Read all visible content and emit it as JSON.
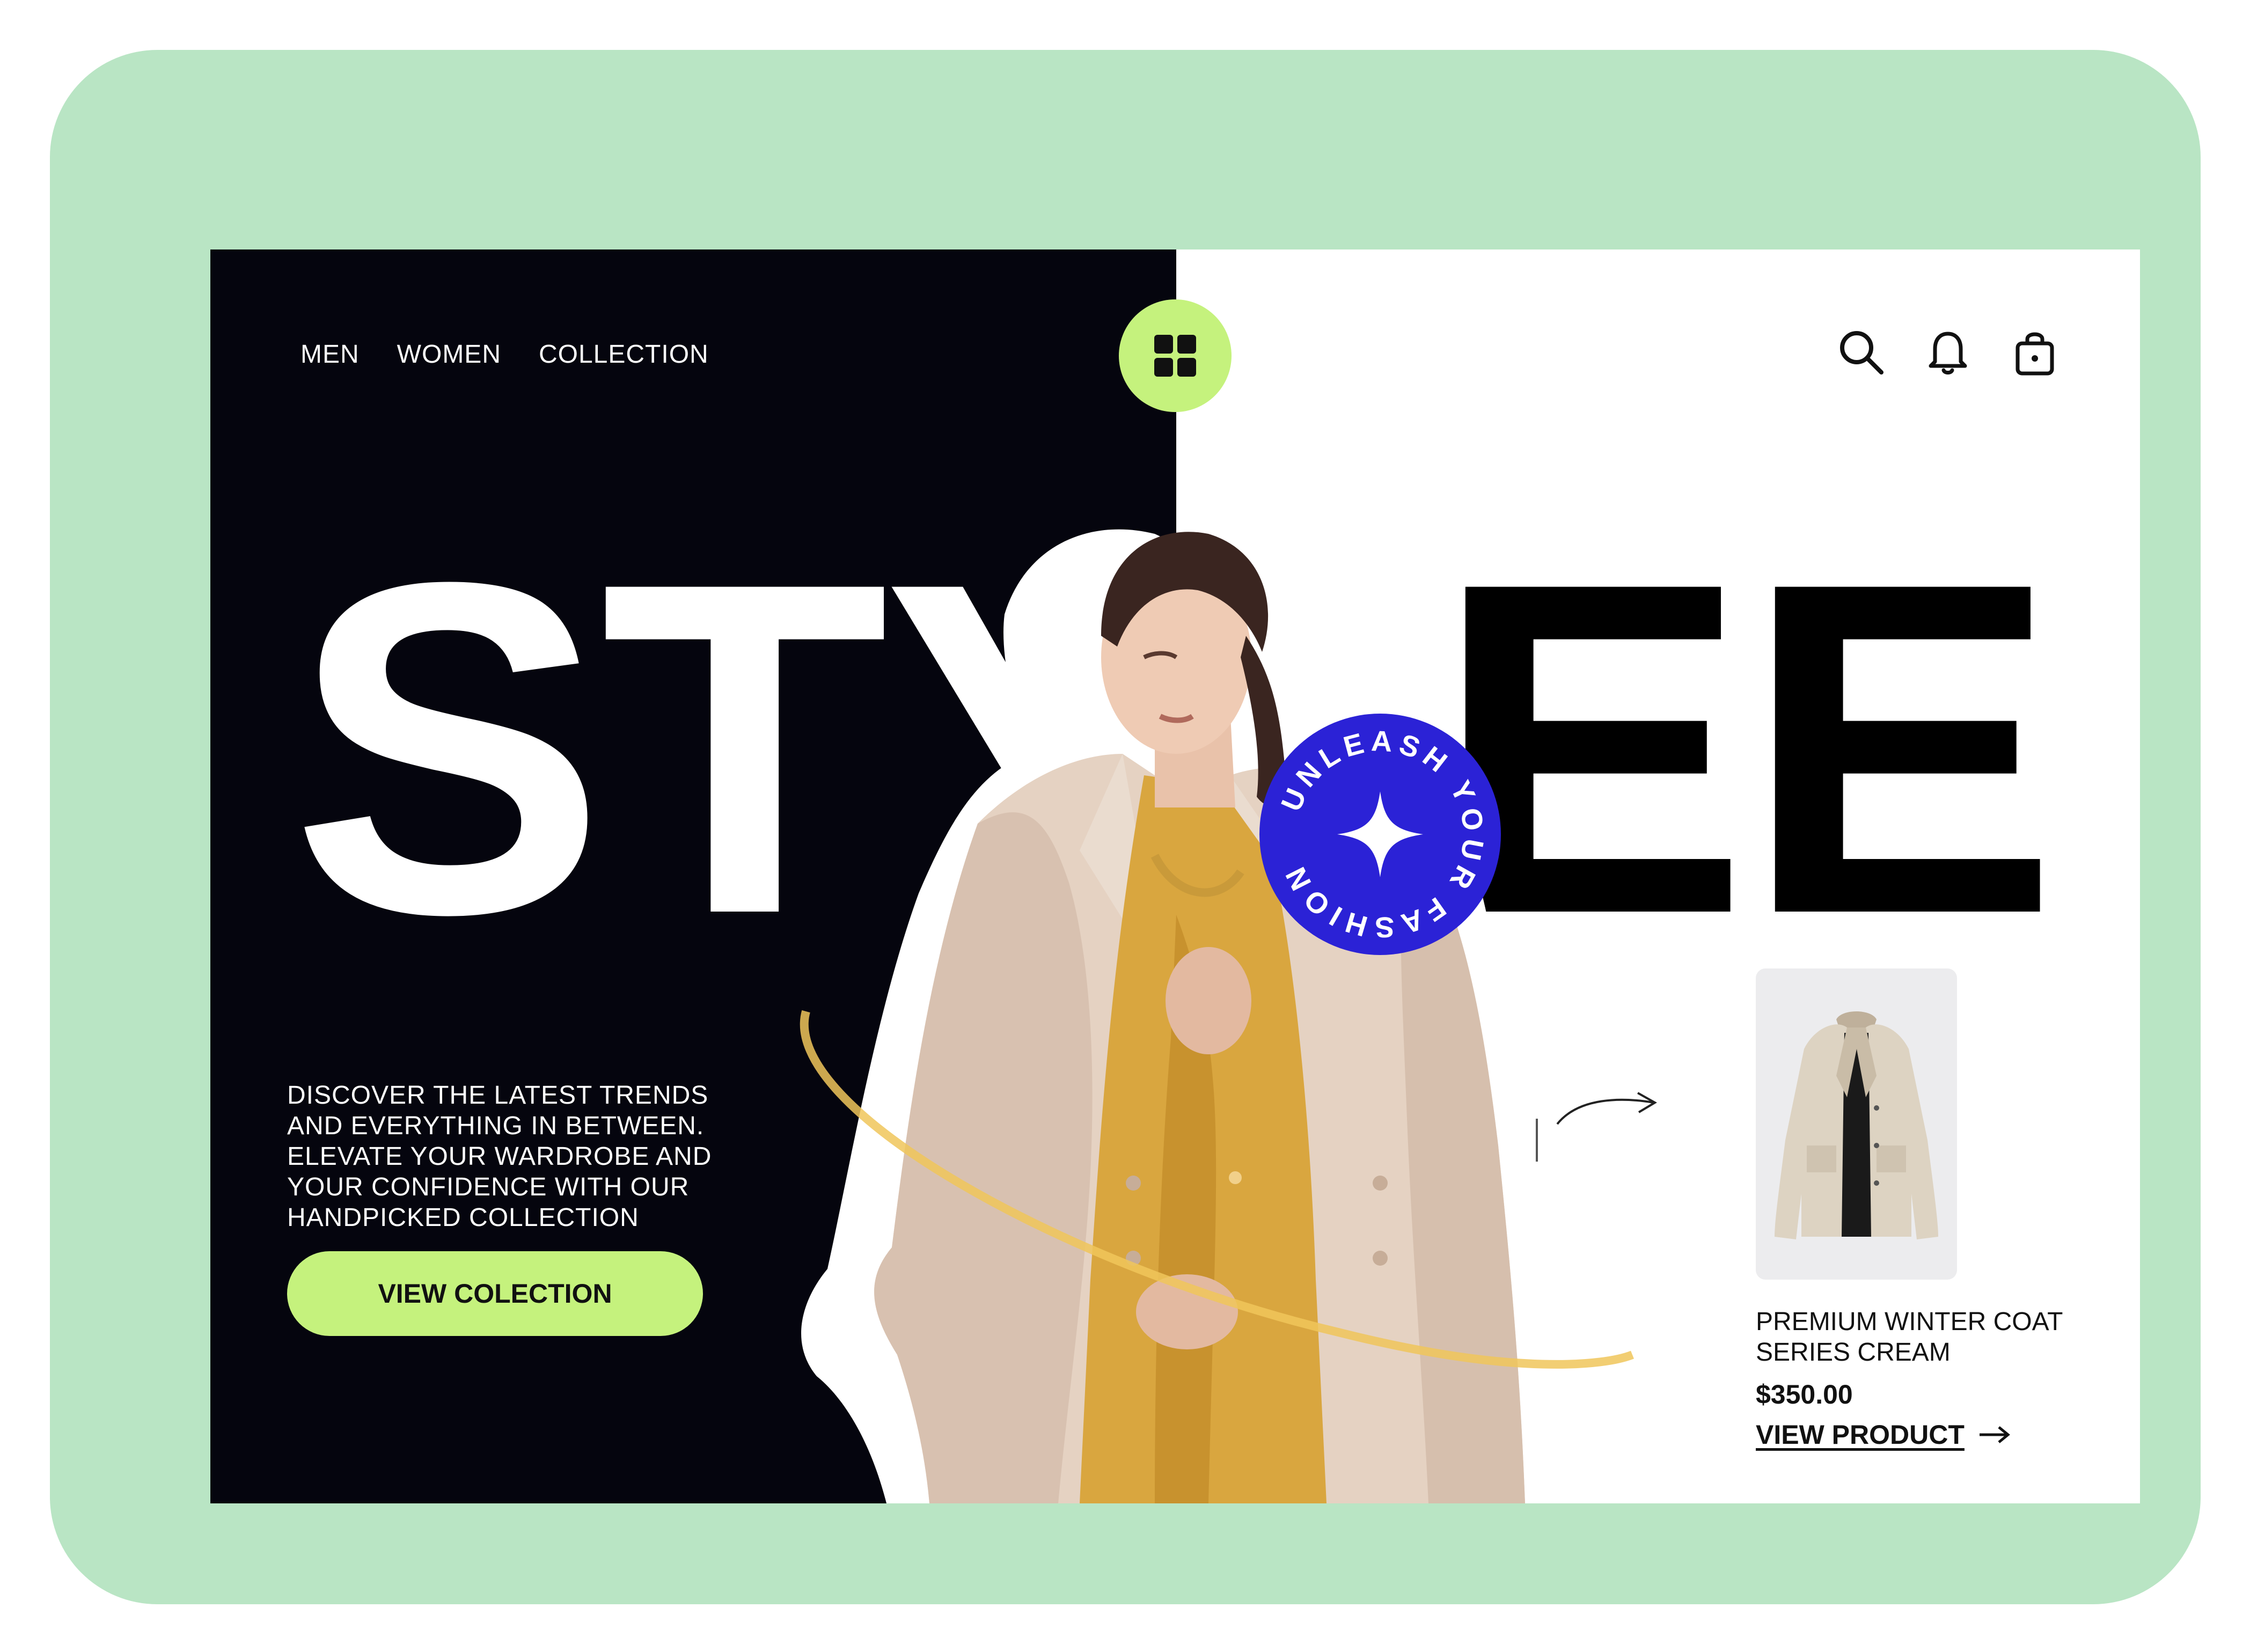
{
  "nav": {
    "items": [
      "MEN",
      "WOMEN",
      "COLLECTION"
    ]
  },
  "hero": {
    "word_left": "STY",
    "word_right": "EE",
    "tagline": "DISCOVER THE LATEST TRENDS AND EVERYTHING IN  BETWEEN. ELEVATE YOUR WARDROBE AND YOUR CONFIDENCE WITH OUR HANDPICKED COLLECTION",
    "cta_label": "VIEW COLECTION"
  },
  "badge": {
    "text": "UNLEASH YOUR FASHION ",
    "color": "#2b22d6"
  },
  "product": {
    "name": "PREMIUM WINTER COAT SERIES CREAM",
    "price": "$350.00",
    "link_label": "VIEW PRODUCT"
  },
  "icons": [
    "grid-menu-icon",
    "search-icon",
    "bell-icon",
    "shopping-bag-icon",
    "arrow-right-icon",
    "sparkle-icon"
  ],
  "colors": {
    "accent": "#c5f27d",
    "dark": "#05050e",
    "frame": "#b9e5c4",
    "badge": "#2b22d6"
  }
}
